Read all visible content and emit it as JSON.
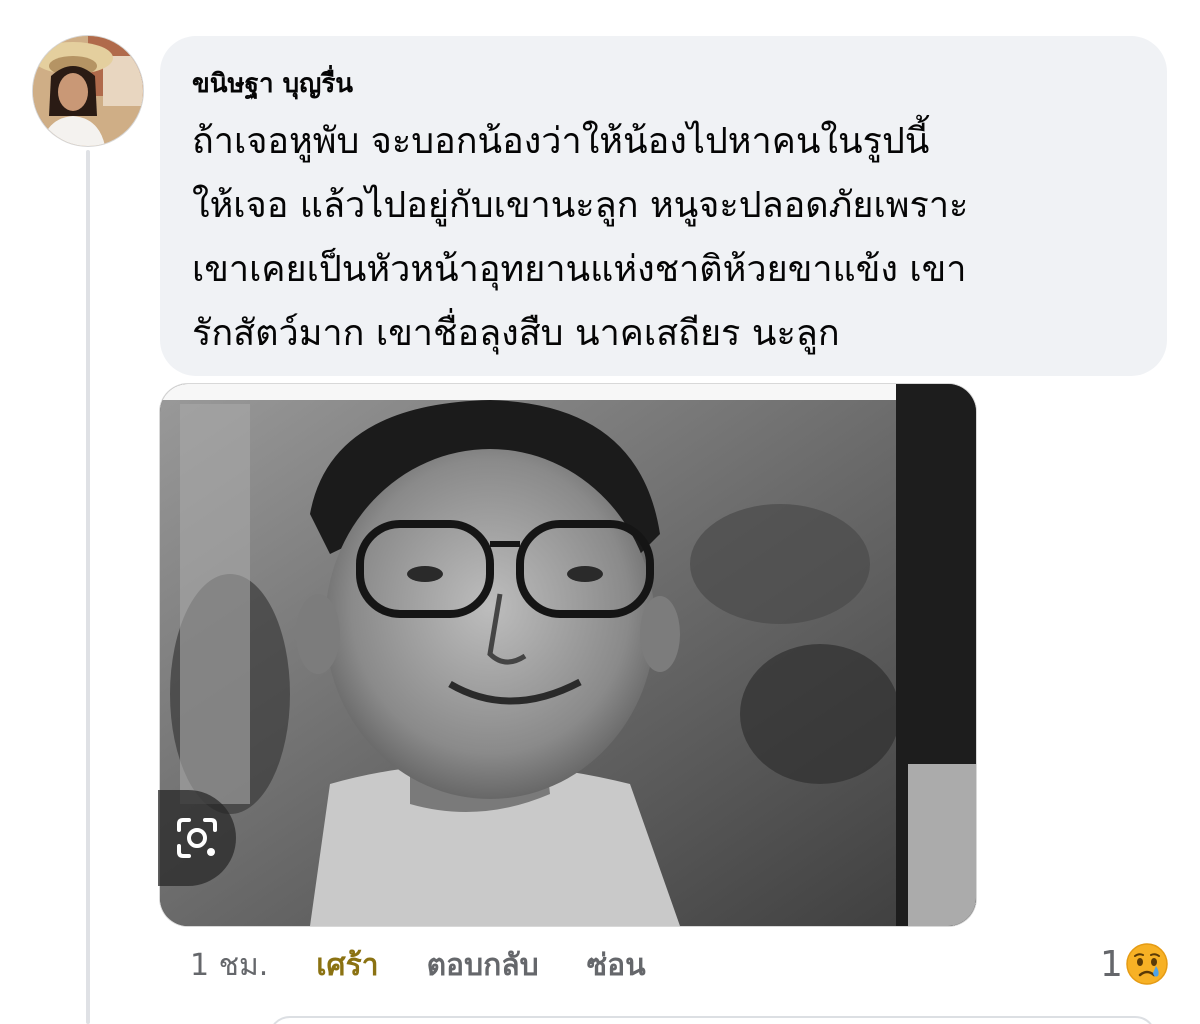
{
  "comment": {
    "author": "ขนิษฐา บุญรื่น",
    "lines": [
      "ถ้าเจอหูพับ จะบอกน้องว่าให้น้องไปหาคนในรูปนี้",
      "ให้เจอ แล้วไปอยู่กับเขานะลูก หนูจะปลอดภัยเพราะ",
      "เขาเคยเป็นหัวหน้าอุทยานแห่งชาติห้วยขาแข้ง เขา",
      "รักสัตว์มาก เขาชื่อลุงสืบ นาคเสถียร นะลูก"
    ]
  },
  "actions": {
    "time": "1 ชม.",
    "reaction_label": "เศร้า",
    "reply_label": "ตอบกลับ",
    "hide_label": "ซ่อน"
  },
  "reactions": {
    "count": "1",
    "emoji": "sad-face-icon"
  },
  "icons": {
    "lens": "camera-lens-icon"
  },
  "colors": {
    "bubble": "#f0f2f5",
    "reaction_sad": "#8b7212",
    "muted_text": "#65676b"
  }
}
